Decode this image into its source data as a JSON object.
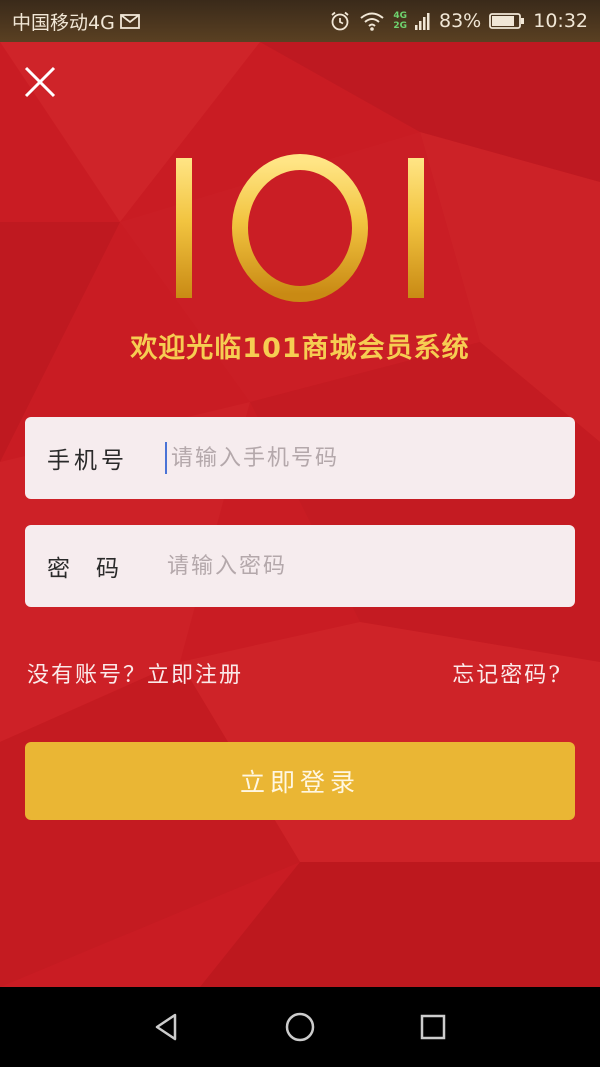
{
  "status_bar": {
    "carrier": "中国移动4G",
    "battery_percent": "83%",
    "time": "10:32",
    "network_top": "4G",
    "network_bottom": "2G",
    "icons": [
      "mail-icon",
      "alarm-icon",
      "wifi-icon",
      "signal-icon",
      "battery-icon"
    ]
  },
  "header": {
    "close_icon": "close-icon",
    "logo_text": "101",
    "welcome": "欢迎光临101商城会员系统"
  },
  "form": {
    "phone": {
      "label": "手机号",
      "placeholder": "请输入手机号码",
      "value": ""
    },
    "password": {
      "label": "密码",
      "placeholder": "请输入密码",
      "value": ""
    },
    "register_link": "没有账号？立即注册",
    "forgot_link": "忘记密码?",
    "login_button": "立即登录"
  },
  "nav": {
    "icons": [
      "back-icon",
      "home-icon",
      "recents-icon"
    ]
  },
  "colors": {
    "background": "#c81d24",
    "gold": "#f6cd52",
    "button": "#eab634",
    "field_bg": "#f6ecee"
  }
}
